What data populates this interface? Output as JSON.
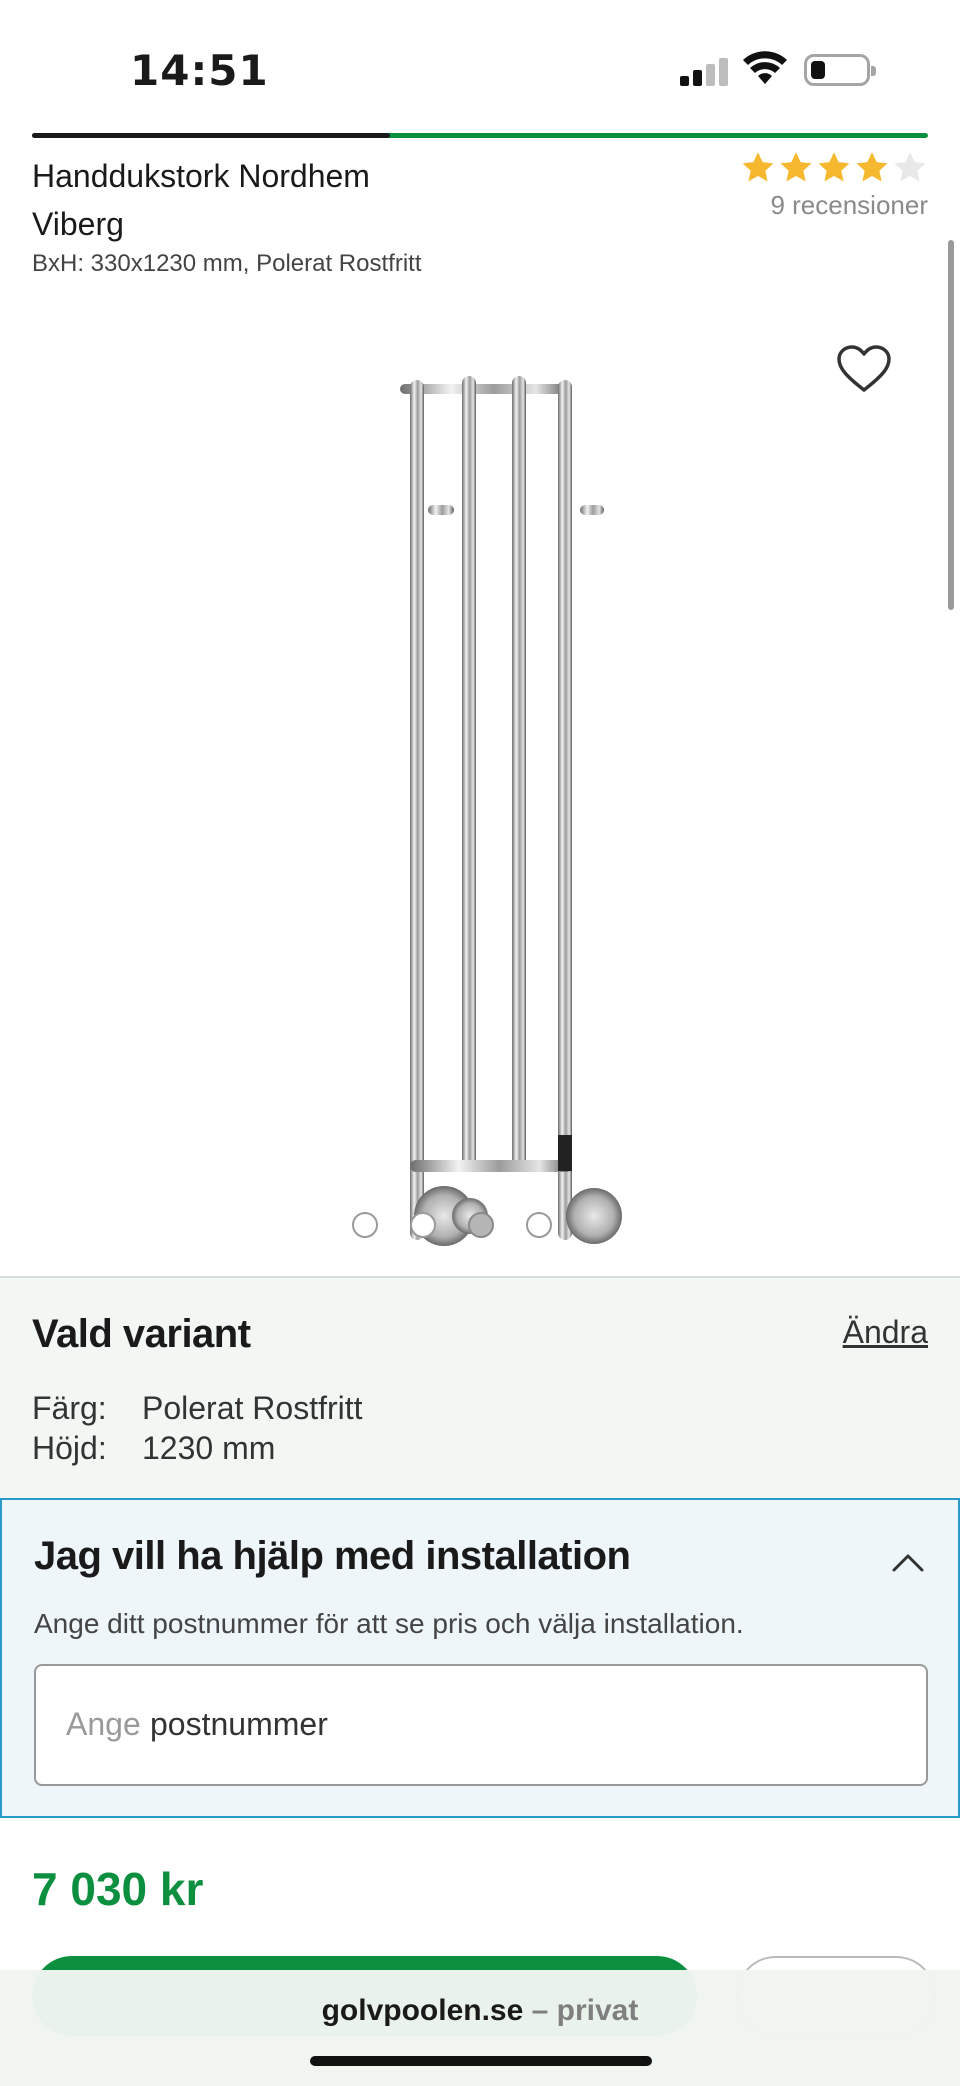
{
  "status_bar": {
    "time": "14:51",
    "icons": [
      "signal-icon",
      "wifi-icon",
      "battery-icon"
    ]
  },
  "page_progress": {
    "fraction": 0.4
  },
  "product": {
    "title": "Handdukstork Nordhem Viberg",
    "subtitle": "BxH: 330x1230 mm, Polerat Rostfritt",
    "rating": {
      "stars": 4,
      "max": 5,
      "reviews_text": "9 recensioner"
    }
  },
  "gallery": {
    "dots": 4,
    "active_dot": 2,
    "favorite_icon": "heart-icon"
  },
  "variant": {
    "title": "Vald variant",
    "change_label": "Ändra",
    "rows": [
      {
        "key": "Färg:",
        "value": "Polerat Rostfritt"
      },
      {
        "key": "Höjd:",
        "value": "1230 mm"
      }
    ]
  },
  "installation": {
    "title": "Jag vill ha hjälp med installation",
    "description": "Ange ditt postnummer för att se pris och välja installation.",
    "input_placeholder": "Ange",
    "input_value": "postnummer",
    "toggle_icon": "chevron-up-icon"
  },
  "price": {
    "amount": "7 030 kr"
  },
  "browser": {
    "domain": "golvpoolen.se",
    "mode": " – privat"
  },
  "colors": {
    "brand_green": "#0c8f3f",
    "star_gold": "#f5b82e",
    "install_border": "#2a9bc8",
    "variant_bg": "#f3f7f4"
  }
}
